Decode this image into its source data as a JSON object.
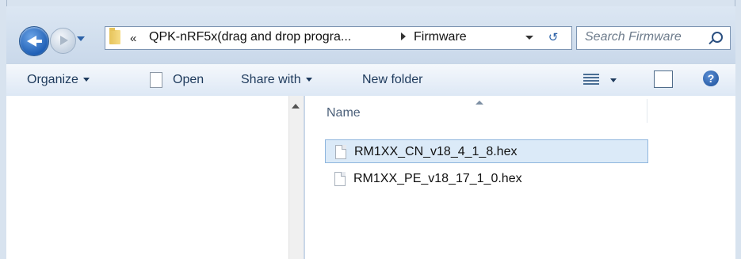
{
  "addressbar": {
    "overflow_chevrons": "«",
    "segment_1": "QPK-nRF5x(drag and drop progra...",
    "segment_2": "Firmware",
    "search_placeholder": "Search Firmware"
  },
  "toolbar": {
    "organize": "Organize",
    "open": "Open",
    "share_with": "Share with",
    "new_folder": "New folder",
    "help": "?"
  },
  "file_list": {
    "column_name": "Name",
    "files": [
      {
        "name": "RM1XX_CN_v18_4_1_8.hex",
        "selected": true
      },
      {
        "name": "RM1XX_PE_v18_17_1_0.hex",
        "selected": false
      }
    ]
  },
  "icons": {
    "back": "back-arrow-icon",
    "forward": "forward-arrow-icon",
    "folder": "folder-icon",
    "refresh": "refresh-icon",
    "search": "search-icon",
    "document": "document-icon",
    "views": "view-list-icon",
    "preview_pane": "preview-pane-icon",
    "help": "help-icon"
  },
  "colors": {
    "selection_bg": "#dbeaf8",
    "selection_border": "#8fb6de",
    "accent": "#1f5fb5"
  }
}
